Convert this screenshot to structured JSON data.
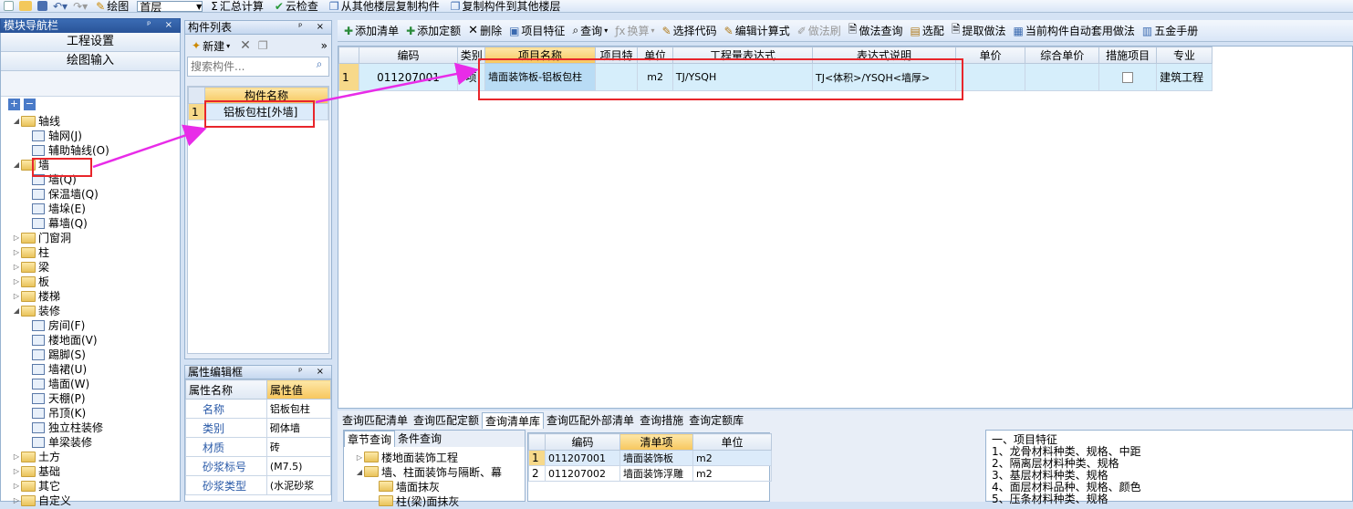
{
  "toolbar1": {
    "draw_label": "绘图",
    "floor_value": "首层",
    "calc": "汇总计算",
    "cloud_check": "云检查",
    "copy_from": "从其他楼层复制构件",
    "copy_to": "复制构件到其他楼层"
  },
  "nav": {
    "title": "模块导航栏",
    "btn_project": "工程设置",
    "btn_draw": "绘图输入",
    "tree": [
      {
        "label": "轴线",
        "level": 0,
        "open": true,
        "type": "folder"
      },
      {
        "label": "轴网(J)",
        "level": 1,
        "type": "leaf"
      },
      {
        "label": "辅助轴线(O)",
        "level": 1,
        "type": "leaf"
      },
      {
        "label": "墙",
        "level": 0,
        "open": true,
        "type": "folder"
      },
      {
        "label": "墙(Q)",
        "level": 1,
        "type": "leaf"
      },
      {
        "label": "保温墙(Q)",
        "level": 1,
        "type": "leaf"
      },
      {
        "label": "墙垛(E)",
        "level": 1,
        "type": "leaf"
      },
      {
        "label": "幕墙(Q)",
        "level": 1,
        "type": "leaf"
      },
      {
        "label": "门窗洞",
        "level": 0,
        "open": false,
        "type": "folder"
      },
      {
        "label": "柱",
        "level": 0,
        "open": false,
        "type": "folder"
      },
      {
        "label": "梁",
        "level": 0,
        "open": false,
        "type": "folder"
      },
      {
        "label": "板",
        "level": 0,
        "open": false,
        "type": "folder"
      },
      {
        "label": "楼梯",
        "level": 0,
        "open": false,
        "type": "folder"
      },
      {
        "label": "装修",
        "level": 0,
        "open": true,
        "type": "folder"
      },
      {
        "label": "房间(F)",
        "level": 1,
        "type": "leaf"
      },
      {
        "label": "楼地面(V)",
        "level": 1,
        "type": "leaf"
      },
      {
        "label": "踢脚(S)",
        "level": 1,
        "type": "leaf"
      },
      {
        "label": "墙裙(U)",
        "level": 1,
        "type": "leaf"
      },
      {
        "label": "墙面(W)",
        "level": 1,
        "type": "leaf"
      },
      {
        "label": "天棚(P)",
        "level": 1,
        "type": "leaf"
      },
      {
        "label": "吊顶(K)",
        "level": 1,
        "type": "leaf"
      },
      {
        "label": "独立柱装修",
        "level": 1,
        "type": "leaf"
      },
      {
        "label": "单梁装修",
        "level": 1,
        "type": "leaf"
      },
      {
        "label": "土方",
        "level": 0,
        "open": false,
        "type": "folder"
      },
      {
        "label": "基础",
        "level": 0,
        "open": false,
        "type": "folder"
      },
      {
        "label": "其它",
        "level": 0,
        "open": false,
        "type": "folder"
      },
      {
        "label": "自定义",
        "level": 0,
        "open": false,
        "type": "folder"
      }
    ]
  },
  "comp": {
    "title": "构件列表",
    "new_label": "新建",
    "search_placeholder": "搜索构件...",
    "col_header": "构件名称",
    "rows": [
      {
        "no": "1",
        "name": "铝板包柱[外墙]"
      }
    ]
  },
  "props": {
    "title": "属性编辑框",
    "col_name": "属性名称",
    "col_value": "属性值",
    "rows": [
      {
        "name": "名称",
        "value": "铝板包柱"
      },
      {
        "name": "类别",
        "value": "砌体墙"
      },
      {
        "name": "材质",
        "value": "砖"
      },
      {
        "name": "砂浆标号",
        "value": "(M7.5)"
      },
      {
        "name": "砂浆类型",
        "value": "(水泥砂浆"
      }
    ]
  },
  "toolbar2": {
    "add_bill": "添加清单",
    "add_quota": "添加定额",
    "delete": "删除",
    "feature": "项目特征",
    "query": "查询",
    "convert": "换算",
    "select_code": "选择代码",
    "edit_formula": "编辑计算式",
    "brush": "做法刷",
    "method_query": "做法查询",
    "match": "选配",
    "extract": "提取做法",
    "auto_apply": "当前构件自动套用做法",
    "hardware": "五金手册"
  },
  "main_grid": {
    "headers": [
      "编码",
      "类别",
      "项目名称",
      "项目特",
      "单位",
      "工程量表达式",
      "表达式说明",
      "单价",
      "综合单价",
      "措施项目",
      "专业"
    ],
    "rows": [
      {
        "no": "1",
        "code": "011207001",
        "type": "项",
        "name": "墙面装饰板-铝板包柱",
        "feature": "",
        "unit": "m2",
        "expr": "TJ/YSQH",
        "desc": "TJ<体积>/YSQH<墙厚>",
        "price": "",
        "comp_price": "",
        "measure": "",
        "major": "建筑工程"
      }
    ]
  },
  "bottom": {
    "tabs": [
      "查询匹配清单",
      "查询匹配定额",
      "查询清单库",
      "查询匹配外部清单",
      "查询措施",
      "查询定额库"
    ],
    "subtabs": [
      "章节查询",
      "条件查询"
    ],
    "tree": [
      "楼地面装饰工程",
      "墙、柱面装饰与隔断、幕",
      "墙面抹灰",
      "柱(梁)面抹灰"
    ],
    "list_headers": [
      "编码",
      "清单项",
      "单位"
    ],
    "list_rows": [
      {
        "no": "1",
        "code": "011207001",
        "name": "墙面装饰板",
        "unit": "m2"
      },
      {
        "no": "2",
        "code": "011207002",
        "name": "墙面装饰浮雕",
        "unit": "m2"
      }
    ],
    "notes": [
      "一、项目特征",
      "1、龙骨材料种类、规格、中距",
      "2、隔离层材料种类、规格",
      "3、基层材料种类、规格",
      "4、面层材料品种、规格、颜色",
      "5、压条材料种类、规格"
    ]
  }
}
